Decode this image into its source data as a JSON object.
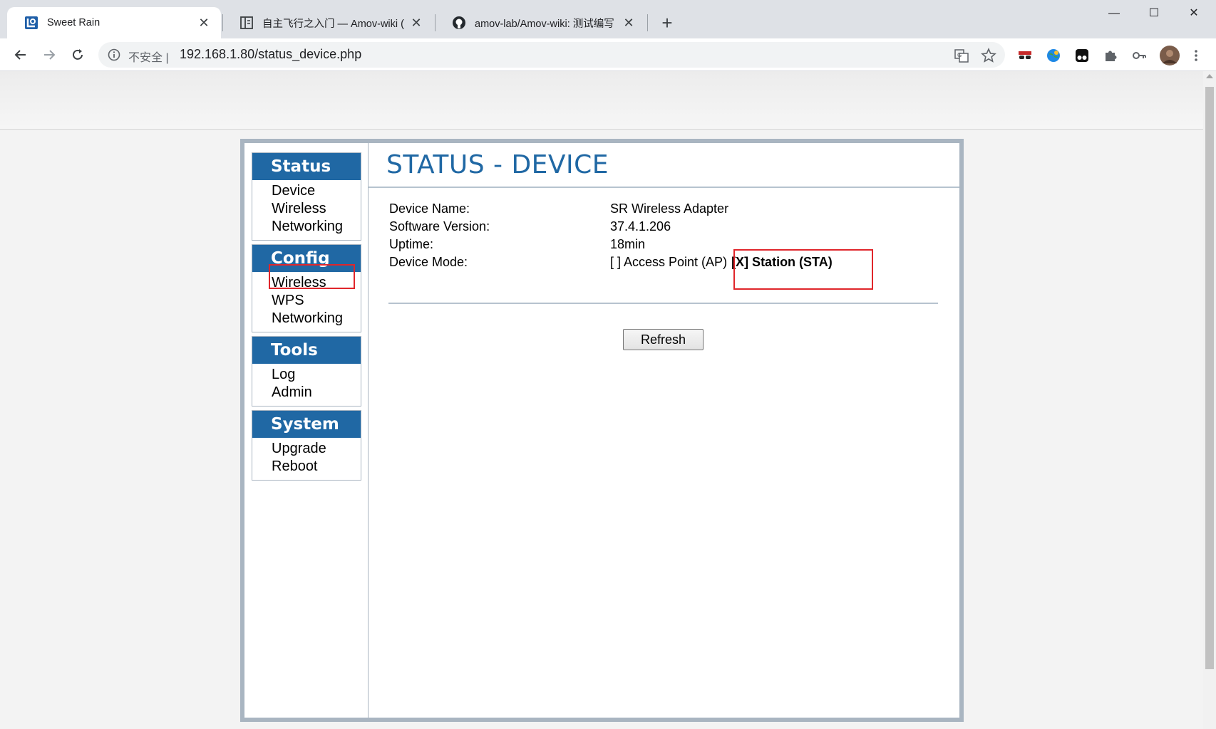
{
  "browser": {
    "tabs": [
      {
        "title": "Sweet Rain",
        "active": true
      },
      {
        "title": "自主飞行之入门 — Amov-wiki (",
        "active": false
      },
      {
        "title": "amov-lab/Amov-wiki: 测试编写",
        "active": false
      }
    ],
    "address": {
      "security_label": "不安全",
      "separator": "|",
      "url": "192.168.1.80/status_device.php"
    },
    "icons": {
      "new_tab": "+",
      "minimize": "—",
      "maximize": "☐",
      "close": "✕",
      "tab_close": "✕"
    }
  },
  "sidebar": {
    "sections": [
      {
        "title": "Status",
        "items": [
          "Device",
          "Wireless",
          "Networking"
        ]
      },
      {
        "title": "Config",
        "items": [
          "Wireless",
          "WPS",
          "Networking"
        ]
      },
      {
        "title": "Tools",
        "items": [
          "Log",
          "Admin"
        ]
      },
      {
        "title": "System",
        "items": [
          "Upgrade",
          "Reboot"
        ]
      }
    ]
  },
  "main": {
    "title": "STATUS - DEVICE",
    "rows": [
      {
        "label": "Device Name:",
        "value": "SR Wireless Adapter"
      },
      {
        "label": "Software Version:",
        "value": "37.4.1.206"
      },
      {
        "label": "Uptime:",
        "value": "18min"
      },
      {
        "label": "Device Mode:",
        "value": "[ ] Access Point (AP)",
        "value_selected": "[X] Station (STA)"
      }
    ],
    "refresh_label": "Refresh"
  },
  "colors": {
    "accent": "#2068a4",
    "frame": "#a9b5c1",
    "highlight": "#e0262b"
  }
}
